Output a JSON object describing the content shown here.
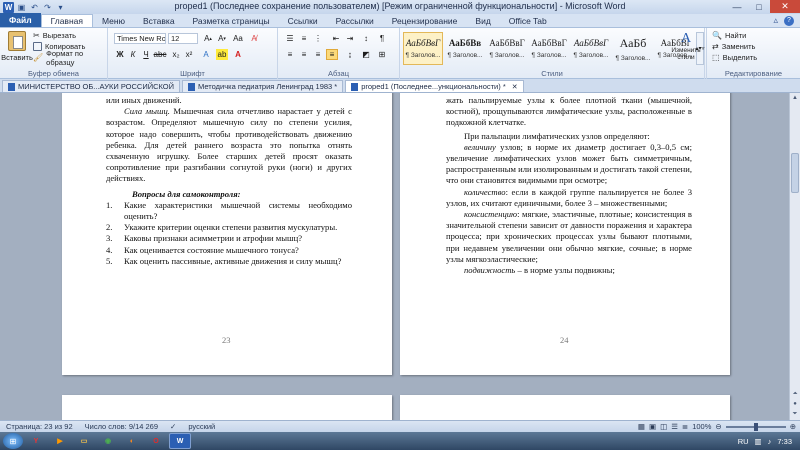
{
  "window": {
    "title": "proped1 (Последнее сохранение пользователем) [Режим ограниченной функциональности] - Microsoft Word",
    "controls": {
      "minimize": "—",
      "maximize": "□",
      "close": "✕"
    }
  },
  "ribbon_tabs": [
    "Файл",
    "Главная",
    "Меню",
    "Вставка",
    "Разметка страницы",
    "Ссылки",
    "Рассылки",
    "Рецензирование",
    "Вид",
    "Office Tab"
  ],
  "clipboard": {
    "paste": "Вставить",
    "cut": "Вырезать",
    "copy": "Копировать",
    "format_painter": "Формат по образцу",
    "label": "Буфер обмена"
  },
  "font": {
    "name": "Times New Ro",
    "size": "12",
    "label": "Шрифт"
  },
  "paragraph": {
    "label": "Абзац"
  },
  "styles": {
    "label": "Стили",
    "items": [
      {
        "sample": "АаБбВвГ",
        "name": "¶ Заголов..."
      },
      {
        "sample": "АаБбВв",
        "name": "¶ Заголов..."
      },
      {
        "sample": "АаБбВвГ",
        "name": "¶ Заголов..."
      },
      {
        "sample": "АаБбВвГ",
        "name": "¶ Заголов..."
      },
      {
        "sample": "АаБбВвГ",
        "name": "¶ Заголов..."
      },
      {
        "sample": "АаБб",
        "name": "¶ Заголов..."
      },
      {
        "sample": "АаБбВі",
        "name": "¶ Заголов..."
      }
    ],
    "change": "Изменить стили"
  },
  "editing": {
    "find": "Найти",
    "replace": "Заменить",
    "select": "Выделить",
    "label": "Редактирование"
  },
  "doc_tabs": [
    {
      "label": "МИНИСТЕРСТВО ОБ...АУКИ РОССИЙСКОЙ"
    },
    {
      "label": "Методичка педиатрия Ленинград 1983 *"
    },
    {
      "label": "proped1 (Последнее...ункциональности) *"
    }
  ],
  "page_left": {
    "top_fragment": "или иных движений.",
    "para1_em": "Сила мышц.",
    "para1_rest": " Мышечная сила отчетливо нарастает у детей с возрастом. Определяют мышечную силу по степени усилия, которое надо совершить, чтобы противодействовать движению ребенка. Для детей раннего возраста это попытка отнять схваченную игрушку. Более старших детей просят оказать сопротивление при разгибании согнутой руки (ноги) и других действиях.",
    "questions_title": "Вопросы для самоконтроля:",
    "questions": [
      {
        "num": "1.",
        "text": "Какие характеристики мышечной системы необходимо оценить?"
      },
      {
        "num": "2.",
        "text": "Укажите критерии оценки степени развития мускулатуры."
      },
      {
        "num": "3.",
        "text": "Каковы признаки асимметрии и атрофии мышц?"
      },
      {
        "num": "4.",
        "text": "Как оценивается состояние мышечного тонуса?"
      },
      {
        "num": "5.",
        "text": "Как оценить пассивные, активные движения и силу мышц?"
      }
    ],
    "page_number": "23"
  },
  "page_right": {
    "top_fragment": "жать пальпируемые узлы к более плотной ткани (мышечной, костной), прощупываются лимфатические узлы, расположенные в подкожной клетчатке.",
    "intro": "При пальпации лимфатических узлов определяют:",
    "items": [
      {
        "term": "величину",
        "text": " узлов; в норме их диаметр достигает 0,3–0,5 см; увеличение лимфатических узлов может быть симметричным, распространенным или изолированным и достигать такой степени, что они становятся видимыми при осмотре;"
      },
      {
        "term": "количество",
        "text": ": если в каждой группе пальпируется не более 3 узлов, их считают единичными, более 3 – множественными;"
      },
      {
        "term": "консистенцию",
        "text": ": мягкие, эластичные, плотные; консистенция в значительной степени зависит от давности поражения и характера процесса; при хронических процессах узлы бывают плотными, при недавнем увеличении они обычно мягкие, сочные; в норме узлы мягкоэластические;"
      },
      {
        "term": "подвижность",
        "text": " – в норме узлы подвижны;"
      }
    ],
    "page_number": "24"
  },
  "statusbar": {
    "page": "Страница: 23 из 92",
    "words": "Число слов: 9/14 269",
    "language": "русский",
    "zoom": "100%"
  },
  "taskbar": {
    "lang": "RU",
    "time": "7:33"
  },
  "colors": {
    "file_tab": "#2a5fa8",
    "close_button": "#c94a3a",
    "style_selected": "#fdf1c7"
  }
}
